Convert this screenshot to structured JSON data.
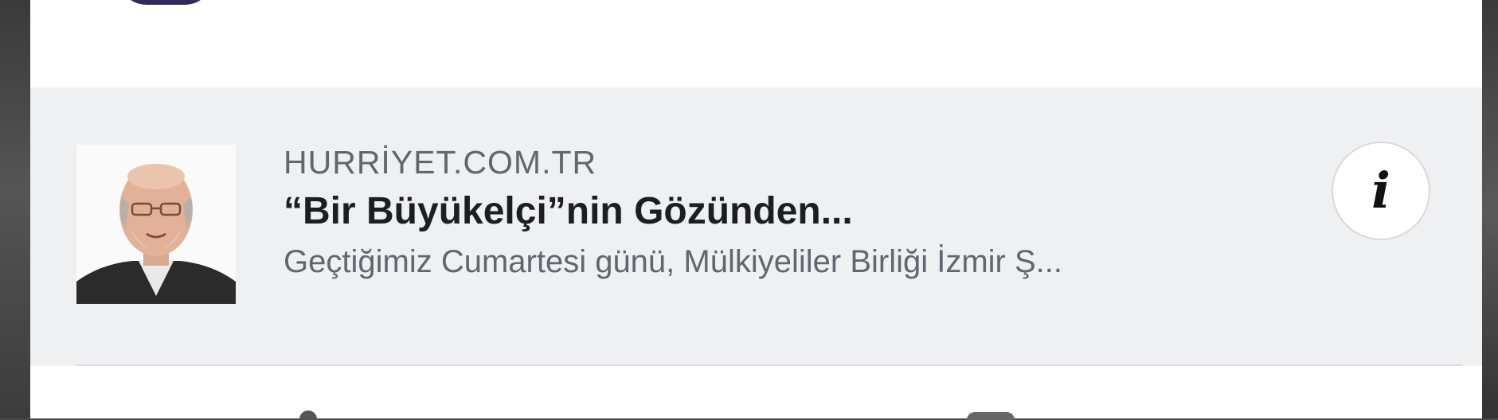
{
  "link_preview": {
    "domain": "HURRİYET.COM.TR",
    "headline": "“Bir Büyükelçi”nin Gözünden...",
    "description": "Geçtiğimiz Cumartesi günü, Mülkiyeliler Birliği İzmir Ş...",
    "thumbnail_icon": "author-portrait",
    "info_button_glyph": "i"
  },
  "colors": {
    "card_background": "#eff0f2",
    "headline": "#1c1e21",
    "secondary_text": "#606770"
  }
}
